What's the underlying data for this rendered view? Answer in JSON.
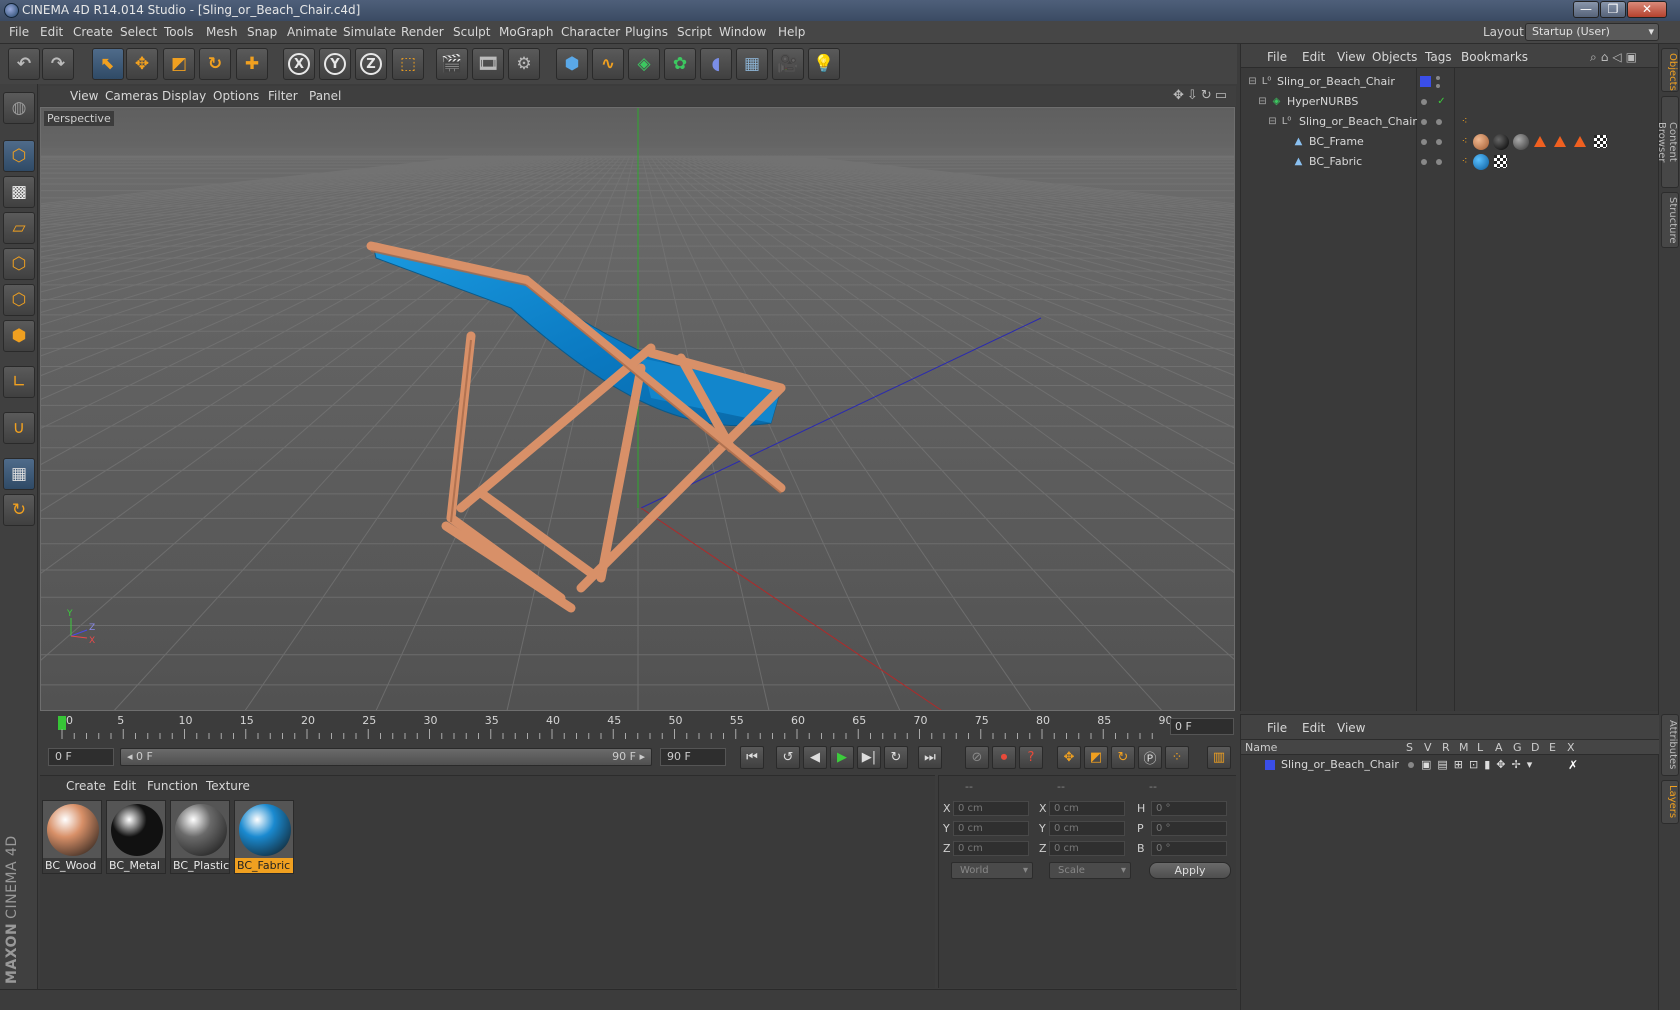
{
  "window": {
    "title": "CINEMA 4D R14.014 Studio - [Sling_or_Beach_Chair.c4d]",
    "minimize": "—",
    "maximize": "❐",
    "close": "✕"
  },
  "menubar": {
    "items": [
      "File",
      "Edit",
      "Create",
      "Select",
      "Tools",
      "Mesh",
      "Snap",
      "Animate",
      "Simulate",
      "Render",
      "Sculpt",
      "MoGraph",
      "Character",
      "Plugins",
      "Script",
      "Window",
      "Help"
    ],
    "layout_label": "Layout:",
    "layout_value": "Startup (User)"
  },
  "toolbar": {
    "icons": [
      "undo-icon",
      "redo-icon",
      "live-selection-icon",
      "move-icon",
      "scale-icon",
      "rotate-icon",
      "add-icon",
      "x-axis-icon",
      "y-axis-icon",
      "z-axis-icon",
      "coordinate-system-icon",
      "render-view-icon",
      "render-picture-viewer-icon",
      "render-settings-icon",
      "cube-icon",
      "spline-icon",
      "nurbs-icon",
      "array-icon",
      "deformer-icon",
      "floor-icon",
      "camera-icon",
      "light-icon"
    ],
    "axis_x": "X",
    "axis_y": "Y",
    "axis_z": "Z"
  },
  "viewport": {
    "menu": [
      "View",
      "Cameras",
      "Display",
      "Options",
      "Filter",
      "Panel"
    ],
    "label": "Perspective",
    "axis_y": "Y",
    "axis_z": "Z",
    "axis_x": "X"
  },
  "timeline": {
    "ticks": [
      "0",
      "5",
      "10",
      "15",
      "20",
      "25",
      "30",
      "35",
      "40",
      "45",
      "50",
      "55",
      "60",
      "65",
      "70",
      "75",
      "80",
      "85",
      "90"
    ],
    "current_frame": "0 F",
    "start_field": "0 F",
    "range_start": "0 F",
    "range_end": "90 F",
    "end_field": "90 F"
  },
  "materials": {
    "menu": [
      "Create",
      "Edit",
      "Function",
      "Texture"
    ],
    "items": [
      {
        "name": "BC_Wood",
        "color": "#d89068"
      },
      {
        "name": "BC_Metal",
        "color": "#111111"
      },
      {
        "name": "BC_Plastic",
        "color": "#6a6a6a"
      },
      {
        "name": "BC_Fabric",
        "color": "#1a8ad0"
      }
    ]
  },
  "coordinates": {
    "header1": "--",
    "header2": "--",
    "header3": "--",
    "x_label": "X",
    "y_label": "Y",
    "z_label": "Z",
    "x2_label": "X",
    "y2_label": "Y",
    "z2_label": "Z",
    "h_label": "H",
    "p_label": "P",
    "b_label": "B",
    "pos_x": "0 cm",
    "pos_y": "0 cm",
    "pos_z": "0 cm",
    "size_x": "0 cm",
    "size_y": "0 cm",
    "size_z": "0 cm",
    "rot_h": "0 °",
    "rot_p": "0 °",
    "rot_b": "0 °",
    "mode1": "World",
    "mode2": "Scale",
    "apply": "Apply"
  },
  "objects": {
    "menu": [
      "File",
      "Edit",
      "View",
      "Objects",
      "Tags",
      "Bookmarks"
    ],
    "rows": [
      {
        "name": "Sling_or_Beach_Chair"
      },
      {
        "name": "HyperNURBS"
      },
      {
        "name": "Sling_or_Beach_Chair"
      },
      {
        "name": "BC_Frame"
      },
      {
        "name": "BC_Fabric"
      }
    ]
  },
  "side_tabs": [
    "Objects",
    "Content Browser",
    "Structure",
    "Attributes",
    "Layers"
  ],
  "layers": {
    "menu": [
      "File",
      "Edit",
      "View"
    ],
    "columns": [
      "Name",
      "S",
      "V",
      "R",
      "M",
      "L",
      "A",
      "G",
      "D",
      "E",
      "X"
    ],
    "row_name": "Sling_or_Beach_Chair"
  },
  "logo": {
    "brand": "MAXON",
    "product": "CINEMA 4D"
  },
  "colors": {
    "accent": "#f0a020",
    "selection": "#4f6b8a",
    "play": "#3ccc3c"
  }
}
